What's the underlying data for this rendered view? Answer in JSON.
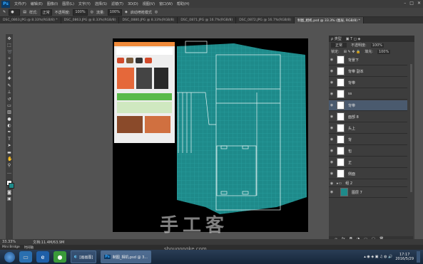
{
  "menubar": {
    "items": [
      "文件(F)",
      "编辑(E)",
      "图像(I)",
      "图层(L)",
      "文字(Y)",
      "选择(S)",
      "滤镜(T)",
      "3D(D)",
      "视图(V)",
      "窗口(W)",
      "帮助(H)"
    ]
  },
  "options": {
    "style_label": "样式:",
    "style_value": "正常",
    "opacity_label": "不透明度:",
    "opacity_value": "100%",
    "flow_label": "流量:",
    "flow_value": "100%",
    "airbrush_label": "启动喷枪模式"
  },
  "tabs": [
    "DSC_0863.JPG @ 8.33%(RGB/8) *",
    "DSC_0863.JPG @ 8.33%(RGB/8)",
    "DSC_0880.JPG @ 8.33%(RGB/8)",
    "DSC_0871.JPG @ 16.7%(RGB/8)",
    "DSC_0872.JPG @ 16.7%(RGB/8)",
    "制图_相机.psd @ 33.3% (图层, RGB/8) *"
  ],
  "panel": {
    "type_label": "ρ 类型",
    "mode_value": "正常",
    "opacity_label": "不透明度:",
    "opacity_value": "100%",
    "lock_label": "锁定:",
    "fill_label": "填充:",
    "fill_value": "100%",
    "layers": [
      {
        "name": "背景下"
      },
      {
        "name": "背带 副本"
      },
      {
        "name": "背带"
      },
      {
        "name": "ss"
      },
      {
        "name": "背带"
      },
      {
        "name": "面部 8"
      },
      {
        "name": "头上"
      },
      {
        "name": "背"
      },
      {
        "name": "包"
      },
      {
        "name": "正"
      },
      {
        "name": "侧面"
      },
      {
        "name": "组 2"
      },
      {
        "name": "图层 7"
      }
    ]
  },
  "status": {
    "zoom": "33.33%",
    "doc": "文档:11.4M/63.9M"
  },
  "bridge": {
    "tabs": [
      "Mini Bridge",
      "时间轴"
    ]
  },
  "taskbar": {
    "task1": "[画画图]",
    "task2": "制图_相机.psd @ 3...",
    "time": "17:17",
    "date": "2016/5/29"
  },
  "watermark": {
    "main": "手工客",
    "sub": "shougongke.com"
  },
  "colors": {
    "teal": "#1e8a8a",
    "accent": "#31a8ff"
  }
}
